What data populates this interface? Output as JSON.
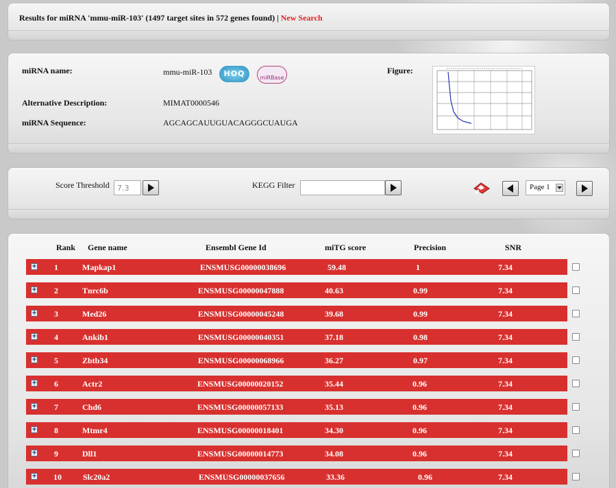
{
  "header": {
    "title": "Results for miRNA 'mmu-miR-103' (1497 target sites in 572 genes found) |",
    "new_search": "New Search"
  },
  "mirna": {
    "name_label": "miRNA name:",
    "name_value": "mmu-miR-103",
    "alt_label": "Alternative Description:",
    "alt_value": "MIMAT0000546",
    "seq_label": "miRNA Sequence:",
    "seq_value": "AGCAGCAUUGUACAGGGCUAUGA",
    "figure_label": "Figure:",
    "logo_hoq": "HOQ",
    "logo_mirbase": "miRBase"
  },
  "controls": {
    "score_label": "Score Threshold",
    "score_value": "7.3",
    "kegg_label": "KEGG Filter",
    "kegg_value": "",
    "page_value": "Page 1"
  },
  "table": {
    "headers": [
      "Rank",
      "Gene name",
      "Ensembl Gene Id",
      "miTG score",
      "Precision",
      "SNR"
    ],
    "rows": [
      {
        "rank": "1",
        "gene": "Mapkap1",
        "ensembl": "ENSMUSG00000038696",
        "score": "59.48",
        "precision": "1",
        "snr": "7.34"
      },
      {
        "rank": "2",
        "gene": "Tnrc6b",
        "ensembl": "ENSMUSG00000047888",
        "score": "40.63",
        "precision": "0.99",
        "snr": "7.34"
      },
      {
        "rank": "3",
        "gene": "Med26",
        "ensembl": "ENSMUSG00000045248",
        "score": "39.68",
        "precision": "0.99",
        "snr": "7.34"
      },
      {
        "rank": "4",
        "gene": "Ankib1",
        "ensembl": "ENSMUSG00000040351",
        "score": "37.18",
        "precision": "0.98",
        "snr": "7.34"
      },
      {
        "rank": "5",
        "gene": "Zbtb34",
        "ensembl": "ENSMUSG00000068966",
        "score": "36.27",
        "precision": "0.97",
        "snr": "7.34"
      },
      {
        "rank": "6",
        "gene": "Actr2",
        "ensembl": "ENSMUSG00000020152",
        "score": "35.44",
        "precision": "0.96",
        "snr": "7.34"
      },
      {
        "rank": "7",
        "gene": "Chd6",
        "ensembl": "ENSMUSG00000057133",
        "score": "35.13",
        "precision": "0.96",
        "snr": "7.34"
      },
      {
        "rank": "8",
        "gene": "Mtmr4",
        "ensembl": "ENSMUSG00000018401",
        "score": "34.30",
        "precision": "0.96",
        "snr": "7.34"
      },
      {
        "rank": "9",
        "gene": "Dll1",
        "ensembl": "ENSMUSG00000014773",
        "score": "34.08",
        "precision": "0.96",
        "snr": "7.34"
      },
      {
        "rank": "10",
        "gene": "Slc20a2",
        "ensembl": "ENSMUSG00000037656",
        "score": "33.36",
        "precision": "0.96",
        "snr": "7.34"
      }
    ]
  },
  "colors": {
    "row_bg": "#d8302e",
    "link": "#dd2222"
  },
  "icons": [
    "expand-icon",
    "save-disk-icon",
    "prev-page-icon",
    "next-page-icon",
    "submit-arrow-icon"
  ]
}
